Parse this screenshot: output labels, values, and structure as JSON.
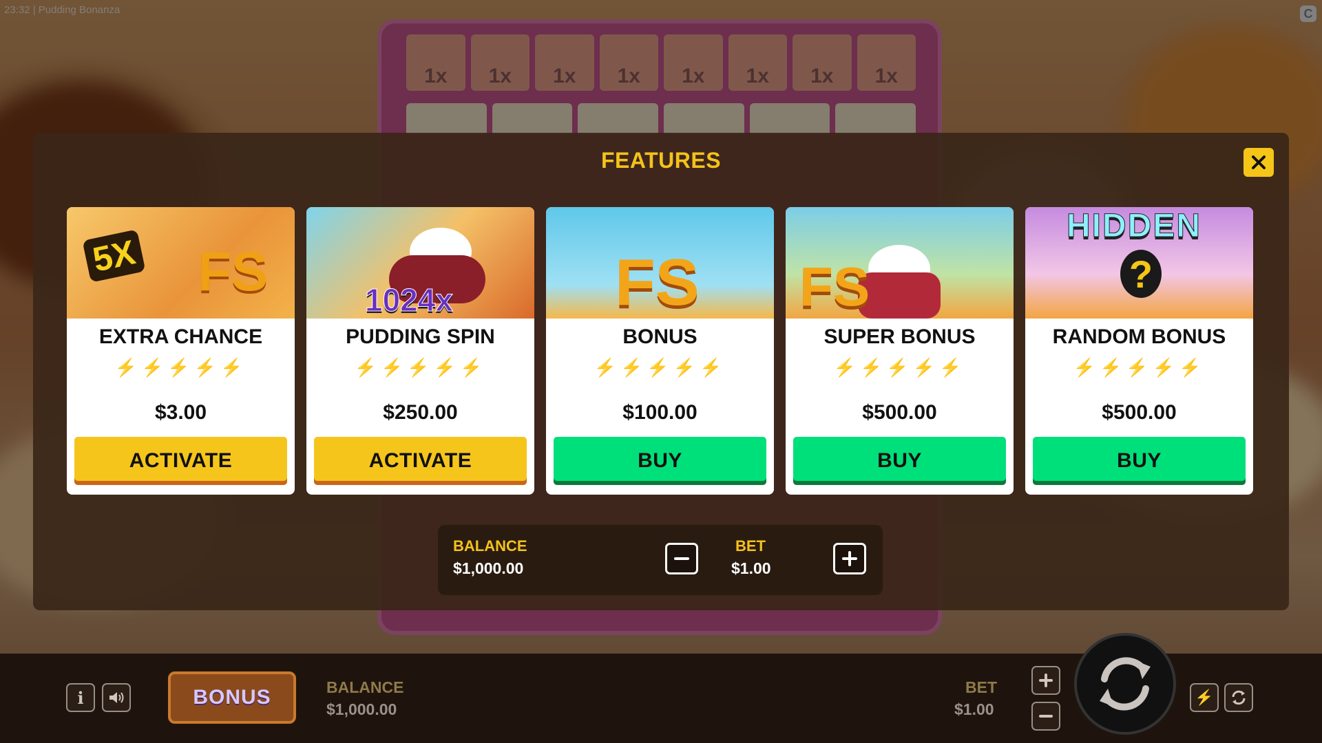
{
  "status": {
    "clock_title": "23:32 | Pudding Bonanza"
  },
  "background": {
    "multiplier_cells": [
      "1x",
      "1x",
      "1x",
      "1x",
      "1x",
      "1x",
      "1x",
      "1x"
    ]
  },
  "modal": {
    "title": "FEATURES",
    "close_icon": "close-icon",
    "cards": [
      {
        "art_text": "5X",
        "art_text2": "FS",
        "name": "EXTRA CHANCE",
        "volatility": 3,
        "volatility_max": 5,
        "price": "$3.00",
        "button": "ACTIVATE",
        "button_color": "#f6c51b"
      },
      {
        "art_text": "1024x",
        "art_text2": "",
        "name": "PUDDING SPIN",
        "volatility": 4,
        "volatility_max": 5,
        "price": "$250.00",
        "button": "ACTIVATE",
        "button_color": "#f6c51b"
      },
      {
        "art_text": "",
        "art_text2": "FS",
        "name": "BONUS",
        "volatility": 4,
        "volatility_max": 5,
        "price": "$100.00",
        "button": "BUY",
        "button_color": "#00e07a"
      },
      {
        "art_text": "",
        "art_text2": "FS",
        "name": "SUPER BONUS",
        "volatility": 4,
        "volatility_max": 5,
        "price": "$500.00",
        "button": "BUY",
        "button_color": "#00e07a"
      },
      {
        "art_text": "HIDDEN",
        "art_text2": "?",
        "name": "RANDOM BONUS",
        "volatility": 5,
        "volatility_max": 5,
        "price": "$500.00",
        "button": "BUY",
        "button_color": "#00e07a"
      }
    ],
    "bet_bar": {
      "balance_label": "BALANCE",
      "balance_value": "$1,000.00",
      "bet_label": "BET",
      "bet_value": "$1.00"
    }
  },
  "hud": {
    "bonus_label": "BONUS",
    "balance_label": "BALANCE",
    "balance_value": "$1,000.00",
    "bet_label": "BET",
    "bet_value": "$1.00"
  },
  "colors": {
    "accent_yellow": "#f4c21a",
    "buy_green": "#00e07a",
    "activate_yellow": "#f6c51b"
  }
}
